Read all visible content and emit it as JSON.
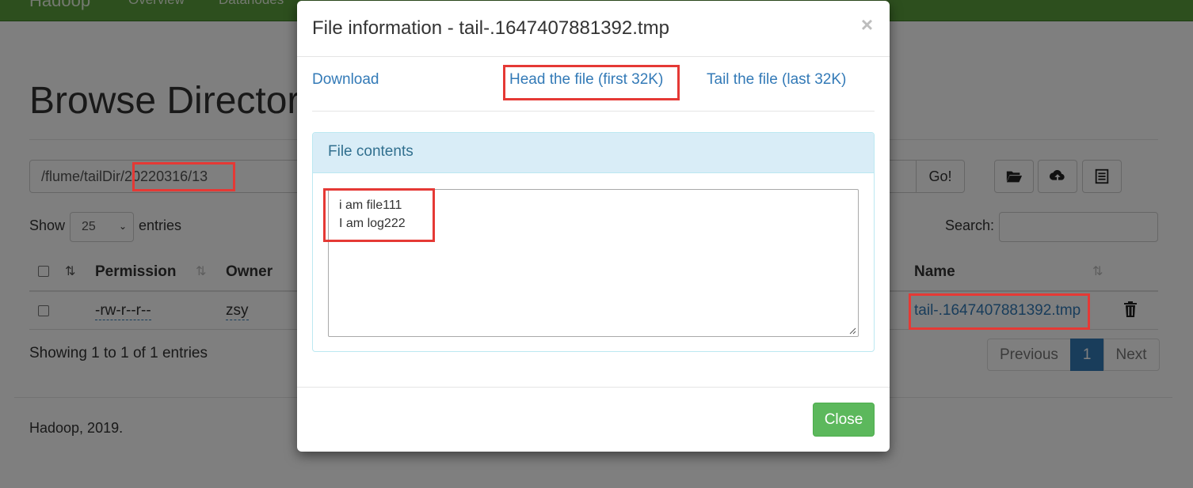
{
  "navbar": {
    "brand": "Hadoop",
    "links": [
      "Overview",
      "Datanodes"
    ]
  },
  "page": {
    "title": "Browse Directory",
    "path_value": "/flume/tailDir/20220316/13",
    "go_label": "Go!",
    "show_label": "Show",
    "entries_per_page": "25",
    "entries_label": "entries",
    "search_label": "Search:",
    "search_value": ""
  },
  "table": {
    "columns": [
      "Permission",
      "Owner",
      "Name"
    ],
    "rows": [
      {
        "permission": "-rw-r--r--",
        "owner": "zsy",
        "name": "tail-.1647407881392.tmp"
      }
    ],
    "showing_text": "Showing 1 to 1 of 1 entries"
  },
  "pagination": {
    "previous": "Previous",
    "current": "1",
    "next": "Next"
  },
  "footer": {
    "text": "Hadoop, 2019."
  },
  "modal": {
    "title": "File information - tail-.1647407881392.tmp",
    "close_x": "×",
    "links": {
      "download": "Download",
      "head": "Head the file (first 32K)",
      "tail": "Tail the file (last 32K)"
    },
    "panel_heading": "File contents",
    "file_lines": [
      "i am file111",
      "I am log222"
    ],
    "close_button": "Close"
  },
  "colors": {
    "navbar": "#5a9f3c",
    "link": "#337ab7",
    "close_button": "#5cb85c",
    "highlight": "#e53935",
    "panel_heading": "#d9edf7"
  },
  "icons": [
    "folder-open-icon",
    "cloud-upload-icon",
    "list-icon",
    "trash-icon",
    "sort-icon",
    "resize-grip-icon"
  ]
}
